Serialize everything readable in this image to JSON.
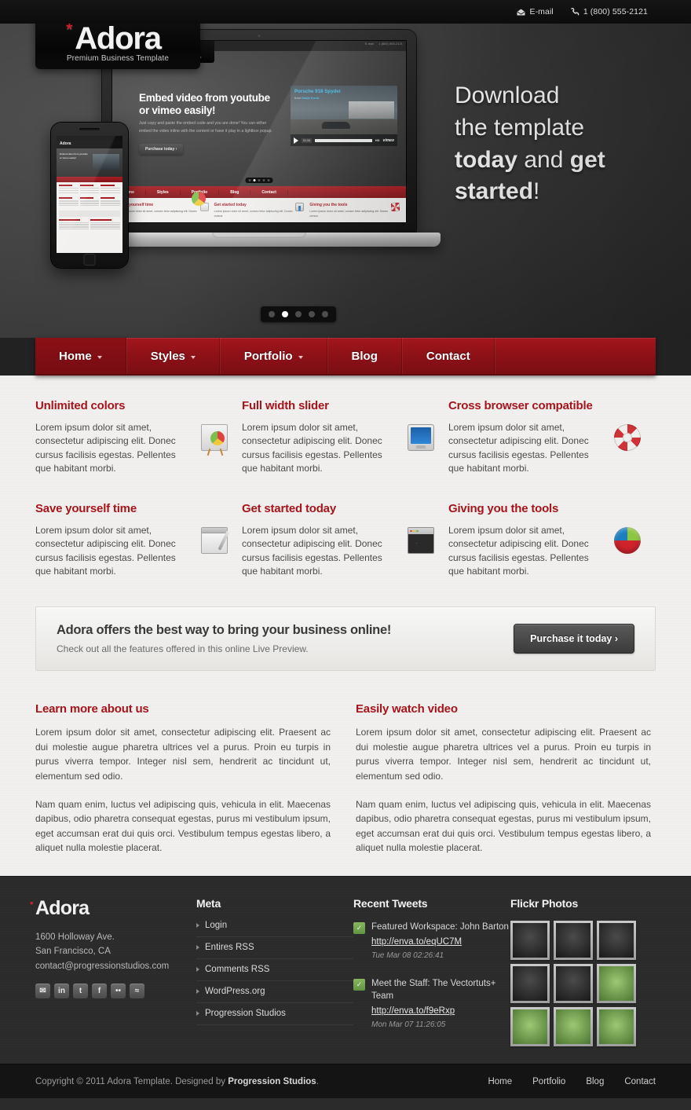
{
  "topbar": {
    "email_label": "E-mail",
    "email_icon": "envelope-icon",
    "phone_label": "1 (800) 555-2121",
    "phone_icon": "phone-icon"
  },
  "brand": {
    "name": "Adora",
    "star": "*",
    "tagline": "Premium Business Template",
    "accent_color": "#c8232c"
  },
  "hero": {
    "headline_line1": "Download",
    "headline_line2": "the template",
    "headline_b1": "today",
    "headline_mid": "and",
    "headline_b2": "get",
    "headline_b3": "started",
    "headline_end": "!",
    "slider_dots": 5,
    "slider_active": 2,
    "mockup": {
      "screen_headline": "Embed video from youtube or vimeo easily!",
      "screen_paragraph": "Just copy and paste the embed code and you are done! You can either embed the video inline with the content or have it play in a lightbox popup.",
      "screen_button": "Purchase today ›",
      "video_title": "Porsche 918 Spyder",
      "video_from_label": "from",
      "video_from_name": "Sadje Kural",
      "video_time": "01:34",
      "video_hd": "HD",
      "video_brand": "vimeo",
      "nav": [
        "Home",
        "Styles",
        "Portfolio",
        "Blog",
        "Contact"
      ],
      "mini_features": [
        {
          "title": "Save yourself time",
          "text": "Lorem ipsum dolor sit amet, consec tetur adipiscing elit. Donec cursus"
        },
        {
          "title": "Get started today",
          "text": "Lorem ipsum dolor sit amet, consec tetur adipiscing elit. Donec cursus"
        },
        {
          "title": "Giving you the tools",
          "text": "Lorem ipsum dolor sit amet, consec tetur adipiscing elit. Donec cursus"
        }
      ]
    }
  },
  "mainnav": {
    "items": [
      {
        "label": "Home",
        "has_dropdown": true,
        "active": true
      },
      {
        "label": "Styles",
        "has_dropdown": true,
        "active": false
      },
      {
        "label": "Portfolio",
        "has_dropdown": true,
        "active": false
      },
      {
        "label": "Blog",
        "has_dropdown": false,
        "active": false
      },
      {
        "label": "Contact",
        "has_dropdown": false,
        "active": false
      }
    ],
    "bg_color": "#8c1117"
  },
  "features": [
    {
      "title": "Unlimited colors",
      "text": "Lorem ipsum dolor sit amet, consectetur adipiscing elit. Donec cursus facilisis egestas. Pellentes que habitant morbi.",
      "icon": "presentation-chart-icon"
    },
    {
      "title": "Full width slider",
      "text": "Lorem ipsum dolor sit amet, consectetur adipiscing elit. Donec cursus facilisis egestas. Pellentes que habitant morbi.",
      "icon": "monitor-icon"
    },
    {
      "title": "Cross browser compatible",
      "text": "Lorem ipsum dolor sit amet, consectetur adipiscing elit. Donec cursus facilisis egestas. Pellentes que habitant morbi.",
      "icon": "life-ring-icon"
    },
    {
      "title": "Save yourself time",
      "text": "Lorem ipsum dolor sit amet, consectetur adipiscing elit. Donec cursus facilisis egestas. Pellentes que habitant morbi.",
      "icon": "notepad-pencil-icon"
    },
    {
      "title": "Get started today",
      "text": "Lorem ipsum dolor sit amet, consectetur adipiscing elit. Donec cursus facilisis egestas. Pellentes que habitant morbi.",
      "icon": "terminal-monitor-icon"
    },
    {
      "title": "Giving you the tools",
      "text": "Lorem ipsum dolor sit amet, consectetur adipiscing elit. Donec cursus facilisis egestas. Pellentes que habitant morbi.",
      "icon": "color-wheel-icon"
    }
  ],
  "cta": {
    "heading": "Adora offers the best way to bring your business online!",
    "subtext": "Check out all the features offered in this online Live Preview.",
    "button": "Purchase it today ›"
  },
  "columns": [
    {
      "title": "Learn more about us",
      "p1": "Lorem ipsum dolor sit amet, consectetur adipiscing elit. Praesent ac dui molestie augue pharetra ultrices vel a purus. Proin eu turpis in purus viverra tempor. Integer nisl sem, hendrerit ac tincidunt ut, elementum sed odio.",
      "p2": "Nam quam enim, luctus vel adipiscing quis, vehicula in elit. Maecenas dapibus, odio pharetra consequat egestas, purus mi vestibulum ipsum, eget accumsan erat dui quis orci. Vestibulum tempus egestas libero, a aliquet nulla molestie placerat."
    },
    {
      "title": "Easily watch video",
      "p1": "Lorem ipsum dolor sit amet, consectetur adipiscing elit. Praesent ac dui molestie augue pharetra ultrices vel a purus. Proin eu turpis in purus viverra tempor. Integer nisl sem, hendrerit ac tincidunt ut, elementum sed odio.",
      "p2": "Nam quam enim, luctus vel adipiscing quis, vehicula in elit. Maecenas dapibus, odio pharetra consequat egestas, purus mi vestibulum ipsum, eget accumsan erat dui quis orci. Vestibulum tempus egestas libero, a aliquet nulla molestie placerat."
    }
  ],
  "footer": {
    "address_line1": "1600 Holloway Ave.",
    "address_line2": "San Francisco, CA",
    "email": "contact@progressionstudios.com",
    "social": [
      {
        "name": "email-icon",
        "glyph": "✉"
      },
      {
        "name": "linkedin-icon",
        "glyph": "in"
      },
      {
        "name": "twitter-icon",
        "glyph": "t"
      },
      {
        "name": "facebook-icon",
        "glyph": "f"
      },
      {
        "name": "flickr-icon",
        "glyph": "••"
      },
      {
        "name": "rss-icon",
        "glyph": "≈"
      }
    ],
    "meta": {
      "heading": "Meta",
      "items": [
        "Login",
        "Entires RSS",
        "Comments RSS",
        "WordPress.org",
        "Progression Studios"
      ]
    },
    "tweets": {
      "heading": "Recent Tweets",
      "items": [
        {
          "text": "Featured Workspace: John Barton",
          "link": "http://enva.to/eqUC7M",
          "date": "Tue Mar 08 02:26:41"
        },
        {
          "text": "Meet the Staff: The Vectortuts+ Team",
          "link": "http://enva.to/f9eRxp",
          "date": "Mon Mar 07 11:26:05"
        }
      ]
    },
    "flickr": {
      "heading": "Flickr Photos",
      "photos": [
        "dark",
        "dark",
        "dark",
        "dark",
        "dark",
        "green",
        "green",
        "green",
        "green"
      ]
    }
  },
  "bottombar": {
    "copyright_pre": "Copyright © 2011 Adora Template. Designed by ",
    "copyright_brand": "Progression Studios",
    "copyright_post": ".",
    "links": [
      "Home",
      "Portfolio",
      "Blog",
      "Contact"
    ]
  }
}
